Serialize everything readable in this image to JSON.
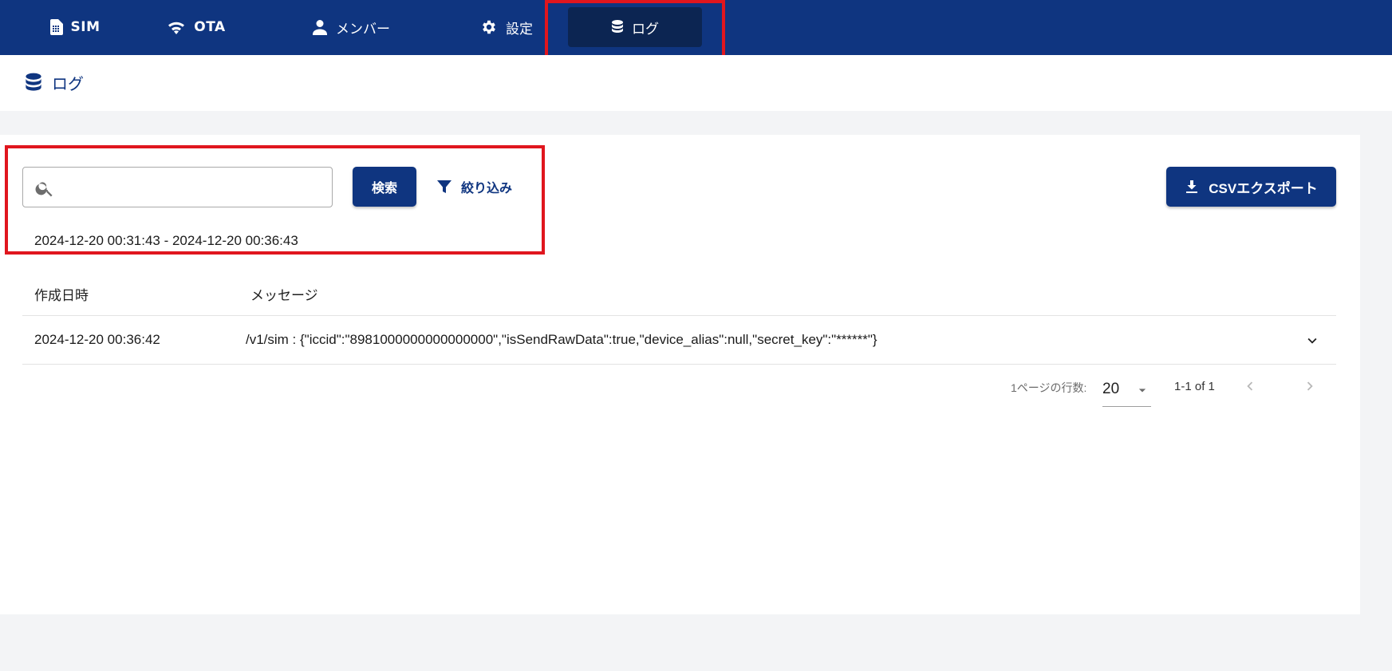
{
  "nav": {
    "items": [
      {
        "label": "SIM",
        "icon": "sim-card-icon"
      },
      {
        "label": "OTA",
        "icon": "wifi-icon"
      },
      {
        "label": "メンバー",
        "icon": "person-icon"
      },
      {
        "label": "設定",
        "icon": "gear-icon"
      },
      {
        "label": "ログ",
        "icon": "database-icon",
        "active": true
      }
    ]
  },
  "page": {
    "title": "ログ",
    "icon": "database-icon"
  },
  "toolbar": {
    "search_value": "",
    "search_placeholder": "",
    "search_button": "検索",
    "filter_button": "絞り込み",
    "export_button": "CSVエクスポート",
    "date_range": "2024-12-20 00:31:43 - 2024-12-20 00:36:43"
  },
  "table": {
    "headers": [
      "作成日時",
      "メッセージ"
    ],
    "rows": [
      {
        "created_at": "2024-12-20 00:36:42",
        "message": "/v1/sim : {\"iccid\":\"8981000000000000000\",\"isSendRawData\":true,\"device_alias\":null,\"secret_key\":\"******\"}"
      }
    ]
  },
  "pagination": {
    "rows_per_page_label": "1ページの行数:",
    "rows_per_page": "20",
    "range": "1-1 of 1"
  },
  "colors": {
    "brand": "#0f3580",
    "active_nav": "#0c2552",
    "highlight": "#e0161e"
  }
}
